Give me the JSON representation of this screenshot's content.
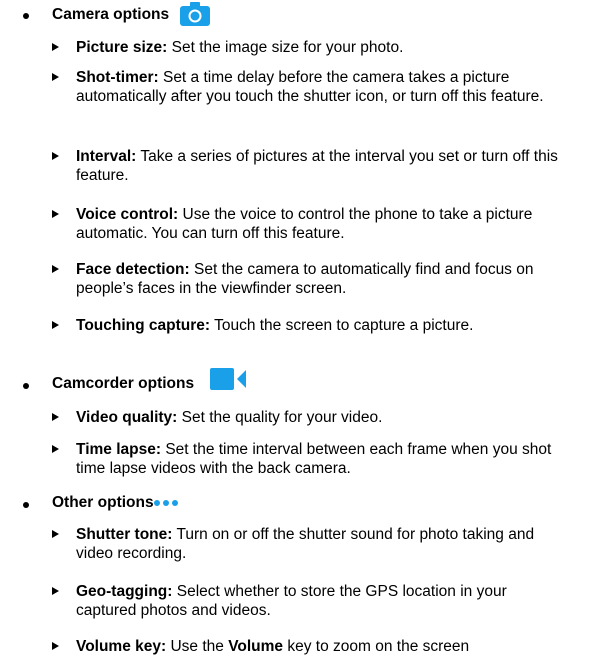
{
  "sections": [
    {
      "title": "Camera options",
      "icon": "camera-icon",
      "icon_color": "#1aa0e8",
      "items": [
        {
          "label": "Picture size:",
          "text": " Set the image size for your photo."
        },
        {
          "label": "Shot-timer:",
          "text": " Set a time delay before the camera takes a picture automatically after you touch the shutter icon, or turn off this feature."
        },
        {
          "label": "Interval:",
          "text": " Take a series of pictures at the interval you set or turn off this feature."
        },
        {
          "label": "Voice control:",
          "text": " Use the voice to control the phone to take a picture automatic. You can turn off this feature."
        },
        {
          "label": "Face detection:",
          "text": " Set the camera to automatically find and focus on people’s faces in the viewfinder screen."
        },
        {
          "label": "Touching capture:",
          "text": " Touch the screen to capture a picture."
        }
      ]
    },
    {
      "title": "Camcorder options",
      "icon": "video-camera-icon",
      "icon_color": "#1aa0e8",
      "items": [
        {
          "label": "Video quality:",
          "text": " Set the quality for your video."
        },
        {
          "label": "Time lapse:",
          "text": " Set the time interval between each frame when you shot time lapse videos with the back camera."
        }
      ]
    },
    {
      "title": "Other options",
      "icon": "more-options-icon",
      "icon_color": "#1aa0e8",
      "items": [
        {
          "label": "Shutter tone:",
          "text": " Turn on or off the shutter sound for photo taking and video recording."
        },
        {
          "label": "Geo-tagging:",
          "text": " Select whether to store the GPS location in your captured photos and videos."
        },
        {
          "label": "Volume key:",
          "text_before": " Use the ",
          "bold_inline": "Volume",
          "text_after": " key to zoom on the screen"
        }
      ]
    }
  ]
}
